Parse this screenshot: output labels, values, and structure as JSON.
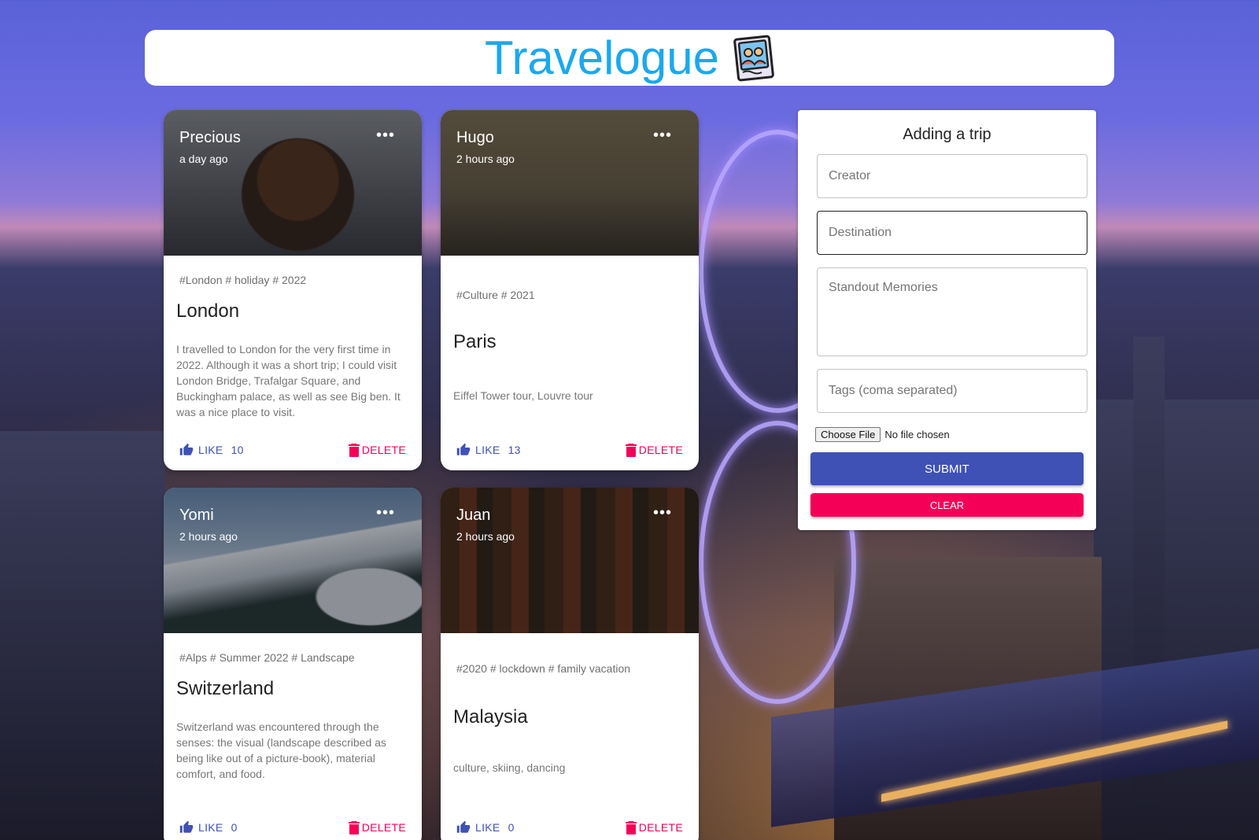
{
  "header": {
    "title": "Travelogue",
    "logo_icon": "photo-album-icon"
  },
  "posts": [
    {
      "creator": "Precious",
      "time": "a day ago",
      "tags": "#London # holiday # 2022",
      "title": "London",
      "message": "I travelled to London for the very first time in 2022. Although it was a short trip; I could visit London Bridge, Trafalgar Square, and Buckingham palace, as well as see Big ben. It was a nice place to visit.",
      "like_label": "LIKE",
      "likes": "10",
      "delete_label": "DELETE"
    },
    {
      "creator": "Hugo",
      "time": "2 hours ago",
      "tags": "#Culture # 2021",
      "title": "Paris",
      "message": "Eiffel Tower tour, Louvre tour",
      "like_label": "LIKE",
      "likes": "13",
      "delete_label": "DELETE"
    },
    {
      "creator": "Yomi",
      "time": "2 hours ago",
      "tags": "#Alps # Summer 2022 # Landscape",
      "title": "Switzerland",
      "message": "Switzerland was encountered through the senses: the visual (landscape described as being like out of a picture-book), material comfort, and food.",
      "like_label": "LIKE",
      "likes": "0",
      "delete_label": "DELETE"
    },
    {
      "creator": "Juan",
      "time": "2 hours ago",
      "tags": "#2020 # lockdown # family vacation",
      "title": "Malaysia",
      "message": "culture, skiing, dancing",
      "like_label": "LIKE",
      "likes": "0",
      "delete_label": "DELETE"
    }
  ],
  "form": {
    "title": "Adding a trip",
    "creator_placeholder": "Creator",
    "destination_placeholder": "Destination",
    "memories_placeholder": "Standout Memories",
    "tags_placeholder": "Tags (coma separated)",
    "choose_file_label": "Choose File",
    "no_file_label": "No file chosen",
    "submit_label": "SUBMIT",
    "clear_label": "CLEAR"
  },
  "colors": {
    "title_blue": "#1ba8ef",
    "primary": "#3f51b5",
    "secondary": "#f50057"
  }
}
